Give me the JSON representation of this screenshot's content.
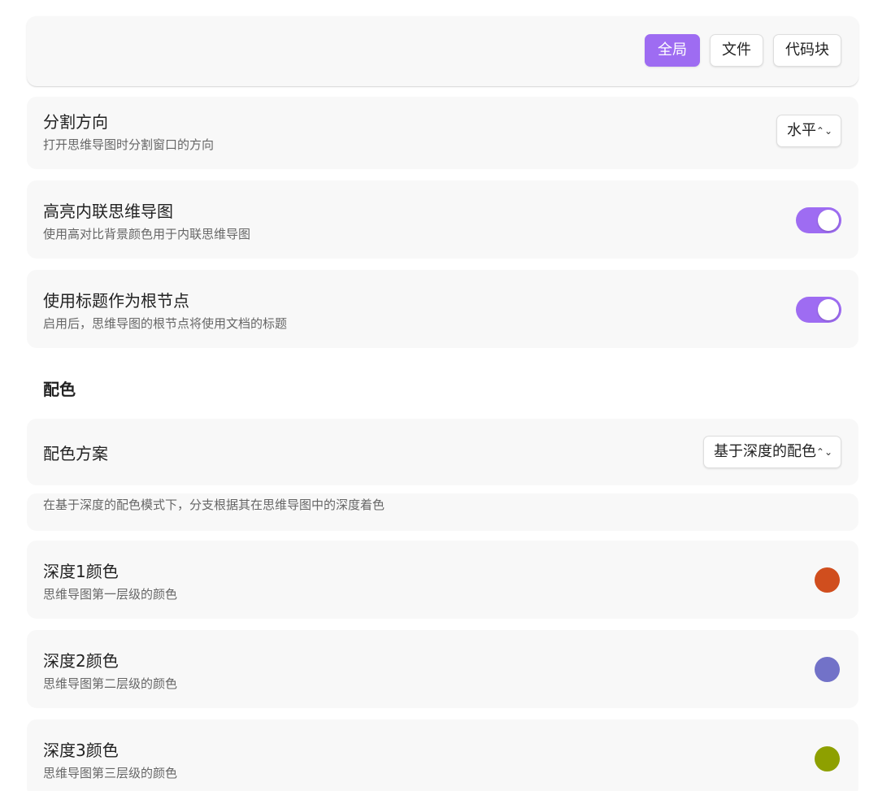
{
  "scope_tabs": {
    "global": "全局",
    "file": "文件",
    "code_block": "代码块"
  },
  "settings": {
    "split_direction": {
      "title": "分割方向",
      "desc": "打开思维导图时分割窗口的方向",
      "value": "水平"
    },
    "highlight_inline": {
      "title": "高亮内联思维导图",
      "desc": "使用高对比背景颜色用于内联思维导图",
      "enabled": true
    },
    "heading_as_root": {
      "title": "使用标题作为根节点",
      "desc": "启用后，思维导图的根节点将使用文档的标题",
      "enabled": true
    }
  },
  "color_section": {
    "heading": "配色",
    "scheme": {
      "title": "配色方案",
      "value": "基于深度的配色",
      "note": "在基于深度的配色模式下，分支根据其在思维导图中的深度着色"
    },
    "depth1": {
      "title": "深度1颜色",
      "desc": "思维导图第一层级的颜色",
      "color": "#d04e1e"
    },
    "depth2": {
      "title": "深度2颜色",
      "desc": "思维导图第二层级的颜色",
      "color": "#7272c8"
    },
    "depth3": {
      "title": "深度3颜色",
      "desc": "思维导图第三层级的颜色",
      "color": "#8ea000"
    }
  },
  "colors": {
    "accent": "#9e6cf2"
  },
  "icons": {
    "select_chevron": "chevron-up-down-icon"
  }
}
